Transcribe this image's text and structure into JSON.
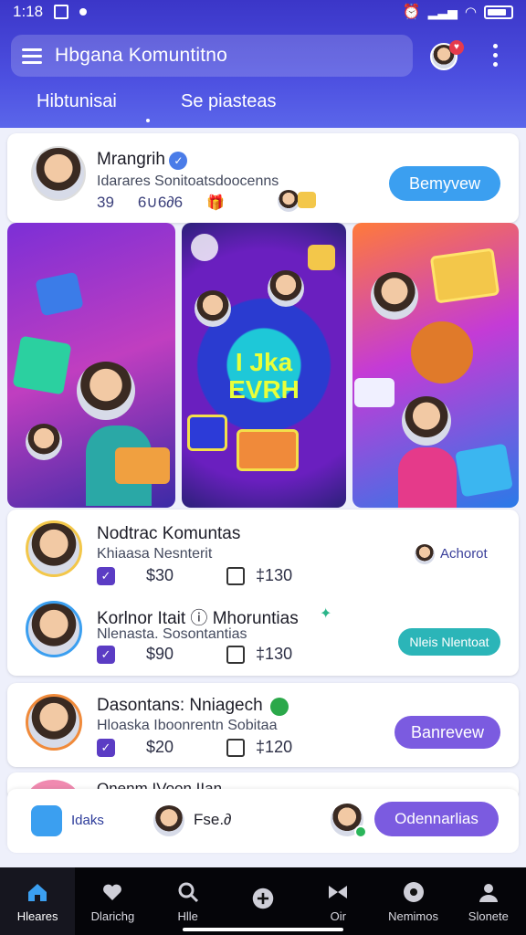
{
  "status_bar": {
    "time": "1:18"
  },
  "header": {
    "search_title": "Hbgana Komuntitno",
    "tabs": [
      {
        "label": "Hibtunisai",
        "active": true
      },
      {
        "label": "Se piasteas",
        "active": false
      }
    ]
  },
  "featured_user": {
    "name": "Mrangrih",
    "subtitle": "Idarares Sonitoatsdoocenns",
    "stat_count": "39",
    "stat_text": "6∪6∂6",
    "button_label": "Bemyvew"
  },
  "banner": {
    "center_text_line1": "I Jka",
    "center_text_line2": "EVRH"
  },
  "group_card": {
    "items": [
      {
        "name": "Nodtrac Komuntas",
        "subtitle": "Khiaasa Nesnterit",
        "price": "$30",
        "likes": "‡130",
        "action_label": "Achorot",
        "action_style": "text"
      },
      {
        "name": "Korlnor Itait ⓘ Mhoruntias",
        "subtitle": "Nlenasta. Sosontantias",
        "price": "$90",
        "likes": "‡130",
        "action_label": "Nleis Nlentoat",
        "action_style": "teal"
      }
    ]
  },
  "single_card": {
    "name": "Dasontans: Nniagech",
    "subtitle": "Hloaska Iboonrentn Sobitaa",
    "price": "$20",
    "likes": "‡120",
    "button_label": "Banrevew"
  },
  "peek_card": {
    "name": "Onenm IVoon IIan"
  },
  "action_bar": {
    "left_label": "Idaks",
    "middle_label": "Fse.∂",
    "button_label": "Odennarlias"
  },
  "nav": {
    "items": [
      {
        "label": "Hleares",
        "icon": "home-icon",
        "active": true
      },
      {
        "label": "Dlarichg",
        "icon": "heart-icon",
        "active": false
      },
      {
        "label": "Hlle",
        "icon": "search-icon",
        "active": false
      },
      {
        "label": "",
        "icon": "plus-icon",
        "active": false
      },
      {
        "label": "Oir",
        "icon": "bow-icon",
        "active": false
      },
      {
        "label": "Nemimos",
        "icon": "game-icon",
        "active": false
      },
      {
        "label": "Slonete",
        "icon": "person-icon",
        "active": false
      }
    ]
  },
  "colors": {
    "header": "#4c4fe0",
    "primary_button": "#3b9ff0",
    "purple_button": "#7b5be0",
    "teal_button": "#2bb5b8",
    "nav_bg": "#050509"
  }
}
